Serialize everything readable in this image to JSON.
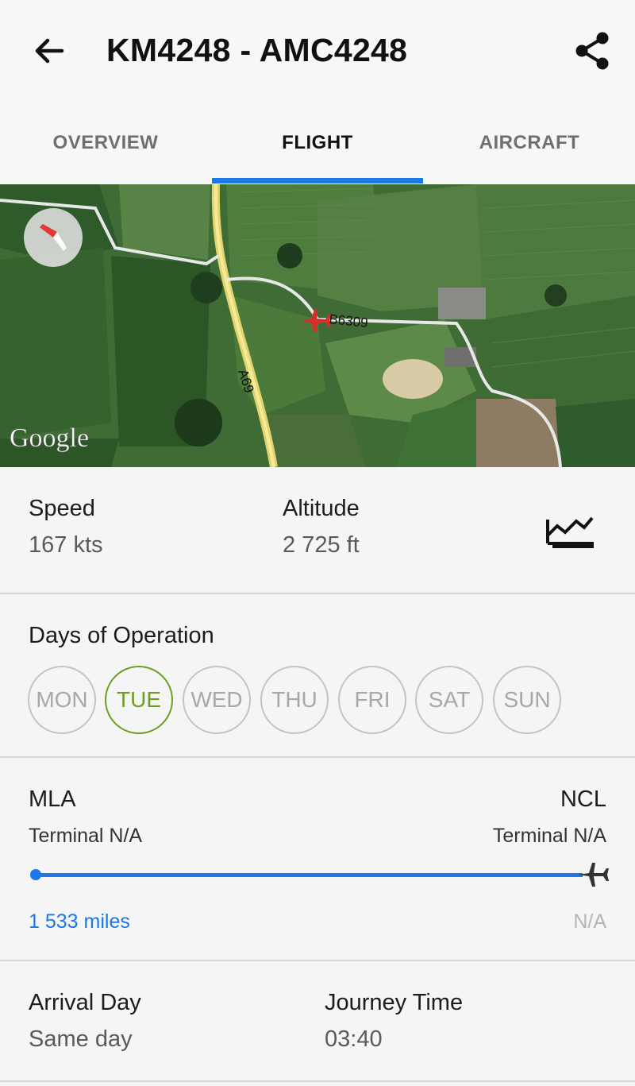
{
  "header": {
    "title": "KM4248 - AMC4248",
    "back_icon": "arrow-left-icon",
    "share_icon": "share-icon"
  },
  "tabs": [
    {
      "label": "OVERVIEW",
      "active": false
    },
    {
      "label": "FLIGHT",
      "active": true
    },
    {
      "label": "AIRCRAFT",
      "active": false
    }
  ],
  "map": {
    "road_a": "A69",
    "road_b": "B6309",
    "attribution": "Google"
  },
  "stats": {
    "speed_label": "Speed",
    "speed_value": "167 kts",
    "altitude_label": "Altitude",
    "altitude_value": "2 725 ft",
    "chart_icon": "line-chart-icon"
  },
  "days": {
    "label": "Days of Operation",
    "items": [
      {
        "label": "MON",
        "active": false
      },
      {
        "label": "TUE",
        "active": true
      },
      {
        "label": "WED",
        "active": false
      },
      {
        "label": "THU",
        "active": false
      },
      {
        "label": "FRI",
        "active": false
      },
      {
        "label": "SAT",
        "active": false
      },
      {
        "label": "SUN",
        "active": false
      }
    ]
  },
  "route": {
    "origin": "MLA",
    "destination": "NCL",
    "origin_terminal": "Terminal N/A",
    "destination_terminal": "Terminal N/A",
    "distance": "1 533 miles",
    "remaining": "N/A",
    "progress": 1.0
  },
  "arrival": {
    "day_label": "Arrival Day",
    "day_value": "Same day",
    "journey_label": "Journey Time",
    "journey_value": "03:40"
  },
  "colors": {
    "accent": "#1b78e6",
    "active_day": "#6e9e1e",
    "aircraft_marker": "#d62d2d"
  }
}
